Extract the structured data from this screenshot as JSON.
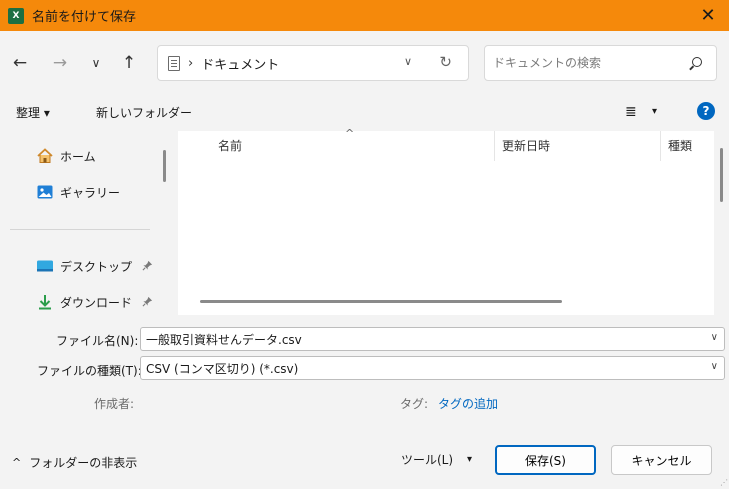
{
  "window": {
    "title": "名前を付けて保存",
    "app_badge": "X",
    "close_glyph": "✕"
  },
  "nav": {
    "back_glyph": "←",
    "forward_glyph": "→",
    "recent_glyph": "∨",
    "up_glyph": "↑",
    "breadcrumb_sep": "›",
    "current_location": "ドキュメント",
    "address_dropdown_glyph": "∨",
    "refresh_glyph": "↻",
    "search_placeholder": "ドキュメントの検索"
  },
  "commands": {
    "organize": "整理 ▾",
    "new_folder": "新しいフォルダー",
    "view_glyph": "≣",
    "view_dropdown_glyph": "▾",
    "help_glyph": "?"
  },
  "sidebar": {
    "items": [
      {
        "label": "ホーム",
        "icon": "home-icon"
      },
      {
        "label": "ギャラリー",
        "icon": "gallery-icon"
      },
      {
        "label": "デスクトップ",
        "icon": "desktop-icon",
        "pinned": true
      },
      {
        "label": "ダウンロード",
        "icon": "download-icon",
        "pinned": true
      }
    ],
    "pin_glyph": "📌"
  },
  "file_list": {
    "sort_glyph": "^",
    "columns": [
      "名前",
      "更新日時",
      "種類"
    ]
  },
  "form": {
    "filename_label": "ファイル名(N):",
    "filename_value": "一般取引資料せんデータ.csv",
    "filetype_label": "ファイルの種類(T):",
    "filetype_value": "CSV (コンマ区切り) (*.csv)",
    "dropdown_glyph": "∨",
    "author_label": "作成者:",
    "tags_label": "タグ:",
    "tags_link": "タグの追加"
  },
  "footer": {
    "hide_folders_glyph": "^",
    "hide_folders": "フォルダーの非表示",
    "tools": "ツール(L)",
    "tools_dropdown_glyph": "▾",
    "save": "保存(S)",
    "cancel": "キャンセル"
  },
  "colors": {
    "titlebar": "#f5890b",
    "accent": "#0067c0",
    "excel_green": "#1d6f42"
  }
}
